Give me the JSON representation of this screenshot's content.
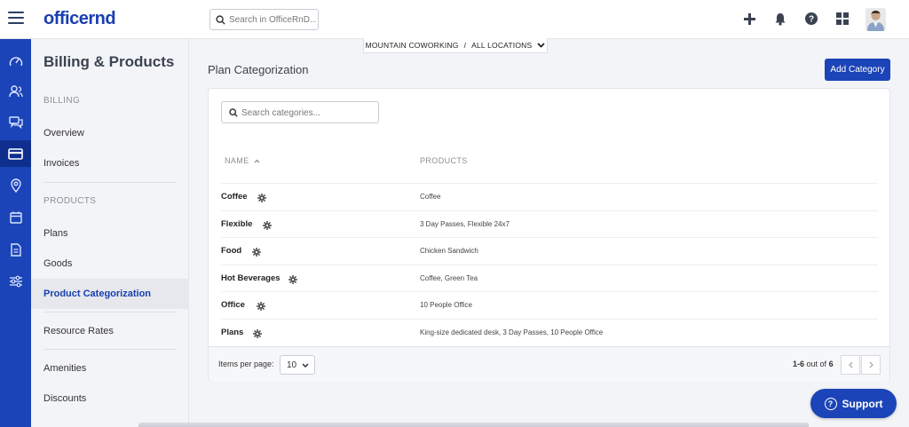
{
  "topbar": {
    "logo": "officernd",
    "search_placeholder": "Search in OfficeRnD...",
    "icons": [
      "plus-icon",
      "bell-icon",
      "help-icon",
      "apps-icon",
      "avatar"
    ]
  },
  "location": {
    "org": "MOUNTAIN COWORKING",
    "separator": "/",
    "scope": "ALL LOCATIONS"
  },
  "rail": {
    "icons": [
      "dashboard-icon",
      "members-icon",
      "chat-icon",
      "billing-card-icon",
      "location-pin-icon",
      "calendar-icon",
      "document-icon",
      "settings-sliders-icon"
    ],
    "active": "billing-card-icon"
  },
  "sidebar": {
    "title": "Billing & Products",
    "billing_section": "BILLING",
    "overview": "Overview",
    "invoices": "Invoices",
    "products_section": "PRODUCTS",
    "plans": "Plans",
    "goods": "Goods",
    "product_categorization": "Product Categorization",
    "resource_rates": "Resource Rates",
    "amenities": "Amenities",
    "discounts": "Discounts"
  },
  "main": {
    "title": "Plan Categorization",
    "add_button": "Add Category",
    "search_placeholder": "Search categories...",
    "col_name": "NAME",
    "col_products": "PRODUCTS",
    "rows": [
      {
        "name": "Coffee",
        "products": "Coffee"
      },
      {
        "name": "Flexible",
        "products": "3 Day Passes, Flexible 24x7"
      },
      {
        "name": "Food",
        "products": "Chicken Sandwich"
      },
      {
        "name": "Hot Beverages",
        "products": "Coffee, Green Tea"
      },
      {
        "name": "Office",
        "products": "10 People Office"
      },
      {
        "name": "Plans",
        "products": "King-size dedicated desk, 3 Day Passes, 10 People Office"
      }
    ],
    "footer": {
      "items_per_page_label": "Items per page:",
      "items_per_page_value": "10",
      "range": "1-6",
      "out_of": "out of",
      "total": "6"
    }
  },
  "support": {
    "label": "Support"
  },
  "colors": {
    "brand": "#1b44b8",
    "rail_active": "#0f2f8e"
  }
}
